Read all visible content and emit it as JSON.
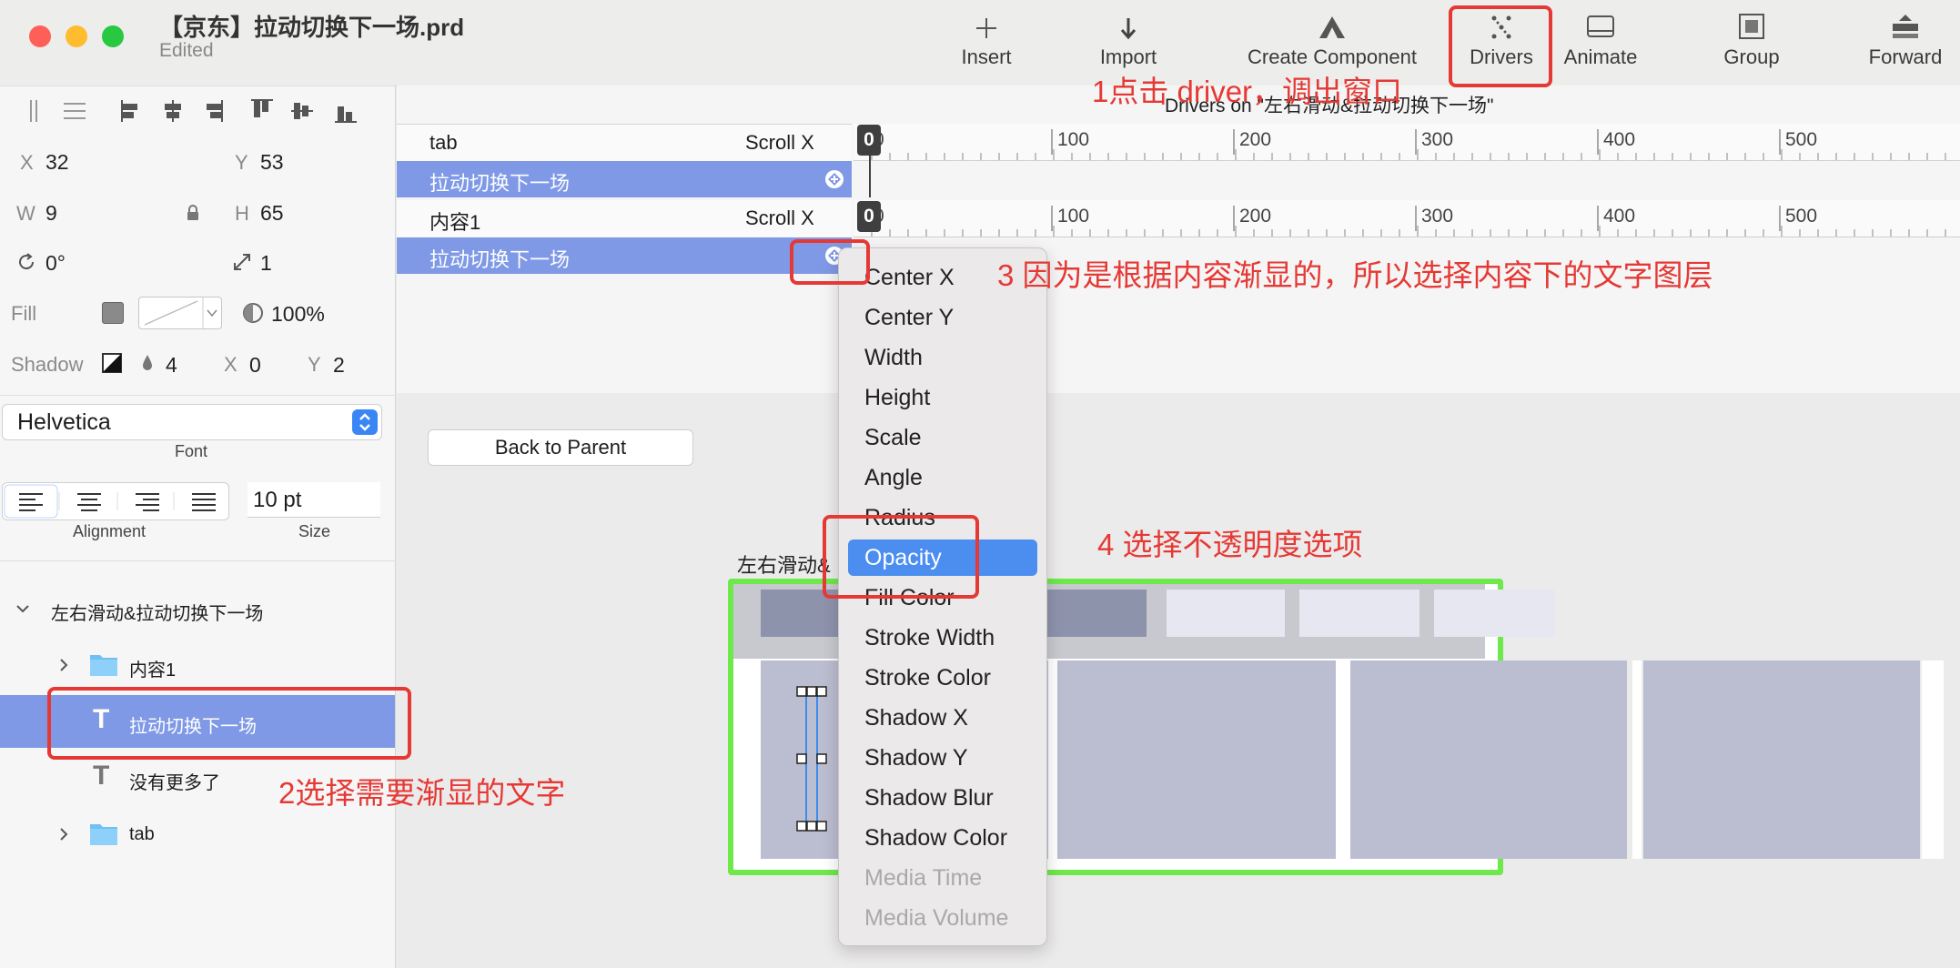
{
  "window": {
    "title": "【京东】拉动切换下一场.prd",
    "status": "Edited"
  },
  "toolbar": {
    "insert": "Insert",
    "import": "Import",
    "create_component": "Create Component",
    "drivers": "Drivers",
    "animate": "Animate",
    "group": "Group",
    "forward": "Forward"
  },
  "inspector": {
    "x_label": "X",
    "x": "32",
    "y_label": "Y",
    "y": "53",
    "w_label": "W",
    "w": "9",
    "h_label": "H",
    "h": "65",
    "angle": "0°",
    "scale": "1",
    "fill_label": "Fill",
    "opacity": "100%",
    "shadow_label": "Shadow",
    "shadow_blur": "4",
    "shadow_x_label": "X",
    "shadow_x": "0",
    "shadow_y_label": "Y",
    "shadow_y": "2",
    "font": "Helvetica",
    "font_caption": "Font",
    "size": "10 pt",
    "alignment_caption": "Alignment",
    "size_caption": "Size"
  },
  "layers": [
    {
      "name": "左右滑动&拉动切换下一场",
      "icon": "chevron-down-icon"
    },
    {
      "name": "内容1",
      "icon": "folder-icon"
    },
    {
      "name": "拉动切换下一场",
      "icon": "text-icon"
    },
    {
      "name": "没有更多了",
      "icon": "text-icon"
    },
    {
      "name": "tab",
      "icon": "folder-icon"
    }
  ],
  "drivers": {
    "title": "Drivers on \"左右滑动&拉动切换下一场\"",
    "rows": [
      {
        "name": "tab",
        "prop": "Scroll X"
      },
      {
        "name": "拉动切换下一场",
        "prop": ""
      },
      {
        "name": "内容1",
        "prop": "Scroll X"
      },
      {
        "name": "拉动切换下一场",
        "prop": ""
      }
    ],
    "ruler_marker": "0",
    "ruler_ticks": [
      "0",
      "100",
      "200",
      "300",
      "400",
      "500"
    ]
  },
  "canvas": {
    "back_button": "Back to Parent",
    "artboard_label": "左右滑动&"
  },
  "menu": {
    "items": [
      "Center X",
      "Center Y",
      "Width",
      "Height",
      "Scale",
      "Angle",
      "Radius",
      "Opacity",
      "Fill Color",
      "Stroke Width",
      "Stroke Color",
      "Shadow X",
      "Shadow Y",
      "Shadow Blur",
      "Shadow Color",
      "Media Time",
      "Media Volume"
    ],
    "selected": "Opacity",
    "disabled": [
      "Media Time",
      "Media Volume"
    ]
  },
  "annotations": {
    "a1": "1点击 driver，调出窗口",
    "a2": "2选择需要渐显的文字",
    "a3": "3 因为是根据内容渐显的，所以选择内容下的文字图层",
    "a4": "4 选择不透明度选项"
  },
  "colors": {
    "accent": "#7f99e6",
    "highlight": "#4b8ef0",
    "annotation": "#e53935",
    "artboard_outline": "#6ee84a"
  }
}
